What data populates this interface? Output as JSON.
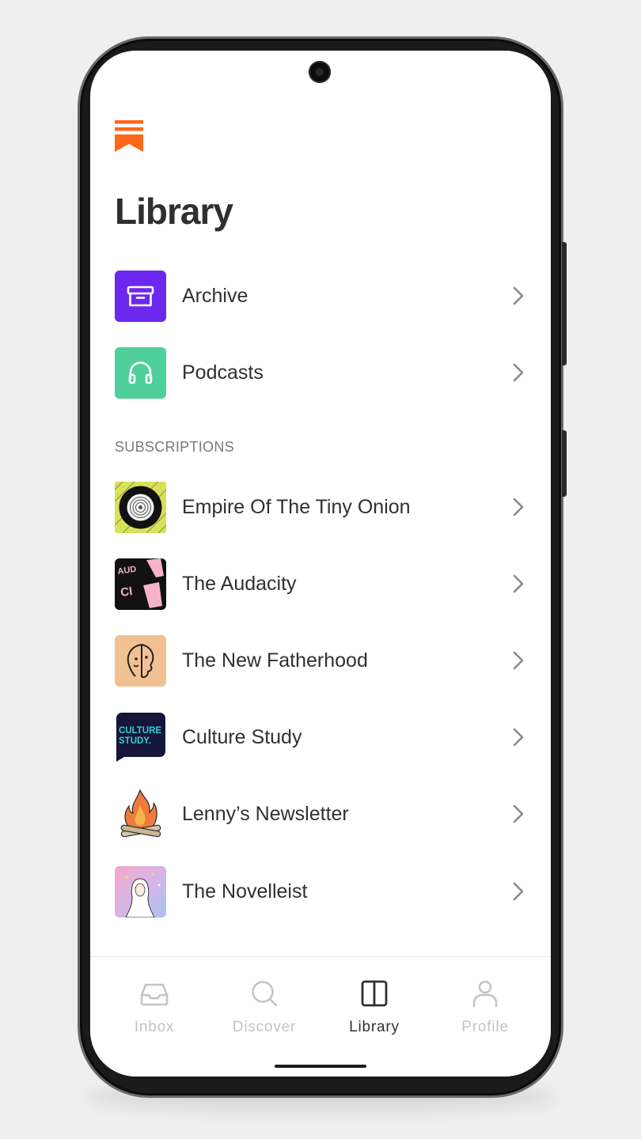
{
  "page": {
    "title": "Library"
  },
  "library_items": [
    {
      "label": "Archive",
      "icon": "archive-box-icon",
      "color": "#6d28f0"
    },
    {
      "label": "Podcasts",
      "icon": "headphones-icon",
      "color": "#4fcf9a"
    }
  ],
  "subscriptions": {
    "section_label": "SUBSCRIPTIONS",
    "items": [
      {
        "label": "Empire Of The Tiny Onion",
        "icon": "onion-thumbnail"
      },
      {
        "label": "The Audacity",
        "icon": "audacity-thumbnail",
        "thumb_text": "THE AUDA CITY"
      },
      {
        "label": "The New Fatherhood",
        "icon": "face-profile-thumbnail"
      },
      {
        "label": "Culture Study",
        "icon": "culture-study-thumbnail",
        "thumb_text": "CULTURE STUDY."
      },
      {
        "label": "Lenny’s Newsletter",
        "icon": "campfire-thumbnail"
      },
      {
        "label": "The Novelleist",
        "icon": "novelleist-thumbnail"
      }
    ]
  },
  "tabbar": {
    "tabs": [
      {
        "label": "Inbox",
        "icon": "inbox-tray-icon",
        "active": false
      },
      {
        "label": "Discover",
        "icon": "search-icon",
        "active": false
      },
      {
        "label": "Library",
        "icon": "library-book-icon",
        "active": true
      },
      {
        "label": "Profile",
        "icon": "person-icon",
        "active": false
      }
    ]
  },
  "colors": {
    "brand": "#ff6719",
    "active_tab": "#303030",
    "inactive_tab": "#c4c4c4"
  }
}
